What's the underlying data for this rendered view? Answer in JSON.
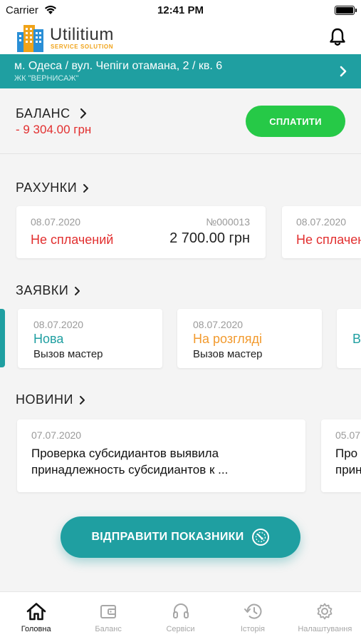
{
  "status_bar": {
    "carrier": "Carrier",
    "time": "12:41 PM"
  },
  "header": {
    "logo_title": "Utilitium",
    "logo_subtitle": "SERVICE SOLUTION"
  },
  "address": {
    "main": "м. Одеса / вул. Чепіги отамана, 2 / кв. 6",
    "sub": "ЖК \"ВЕРНИСАЖ\""
  },
  "balance": {
    "title": "БАЛАНС",
    "value": "- 9 304.00 грн",
    "pay_label": "СПЛАТИТИ"
  },
  "bills": {
    "title": "РАХУНКИ",
    "items": [
      {
        "date": "08.07.2020",
        "number": "№000013",
        "status": "Не сплачений",
        "amount": "2 700.00 грн"
      },
      {
        "date": "08.07.2020",
        "status": "Не сплачений"
      }
    ]
  },
  "requests": {
    "title": "ЗАЯВКИ",
    "items": [
      {
        "date": "08.07.2020",
        "status": "Нова",
        "description": "Вызов мастер"
      },
      {
        "date": "08.07.2020",
        "status": "На розгляді",
        "description": "Вызов мастер"
      },
      {
        "status": "В"
      }
    ]
  },
  "news": {
    "title": "НОВИНИ",
    "items": [
      {
        "date": "07.07.2020",
        "text": "Проверка субсидиантов выявила принадлежность субсидиантов к ..."
      },
      {
        "date": "05.07",
        "text": "Про прин"
      }
    ]
  },
  "submit_label": "ВІДПРАВИТИ ПОКАЗНИКИ",
  "tabs": [
    {
      "label": "Головна",
      "icon": "home-icon",
      "active": true
    },
    {
      "label": "Баланс",
      "icon": "wallet-icon"
    },
    {
      "label": "Сервіси",
      "icon": "headset-icon"
    },
    {
      "label": "Історія",
      "icon": "history-icon"
    },
    {
      "label": "Налаштування",
      "icon": "gear-icon"
    }
  ],
  "colors": {
    "teal": "#1f9fa1",
    "pay_green": "#26c947",
    "debt_red": "#e22f2f",
    "status_new": "#1f9fa1",
    "status_review": "#f29a2e"
  }
}
